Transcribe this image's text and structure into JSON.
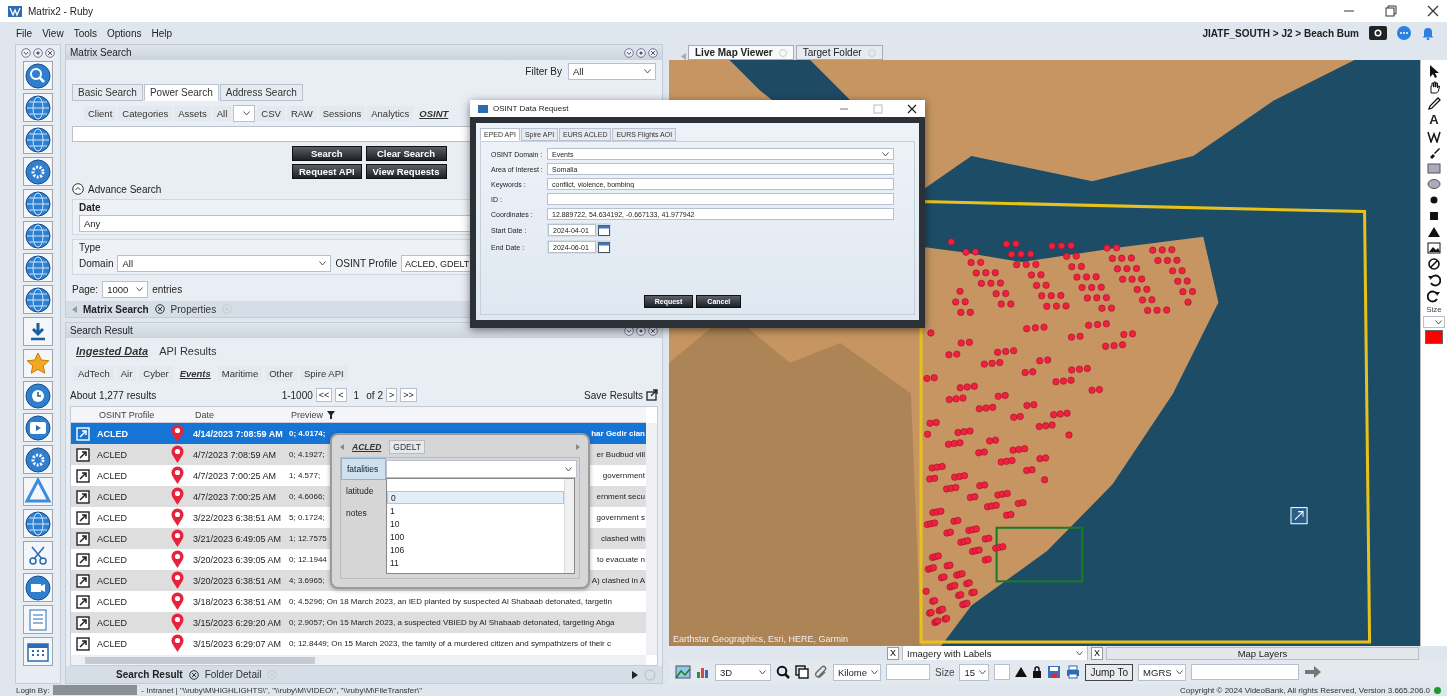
{
  "window": {
    "title": "Matrix2 - Ruby",
    "breadcrumb": "JIATF_SOUTH > J2 > Beach Bum"
  },
  "menu": [
    "File",
    "View",
    "Tools",
    "Options",
    "Help"
  ],
  "matrix_search": {
    "title": "Matrix Search",
    "filter_label": "Filter By",
    "filter_value": "All",
    "tabs": [
      {
        "label": "Basic Search",
        "selected": false
      },
      {
        "label": "Power Search",
        "selected": true
      },
      {
        "label": "Address Search",
        "selected": false
      }
    ],
    "categories": [
      {
        "kind": "tab",
        "label": "Client",
        "selected": false
      },
      {
        "kind": "tab",
        "label": "Categories",
        "selected": false
      },
      {
        "kind": "tab",
        "label": "Assets",
        "selected": false
      },
      {
        "kind": "tab",
        "label": "All",
        "selected": false
      },
      {
        "kind": "dropdown"
      },
      {
        "kind": "tab",
        "label": "CSV",
        "selected": false
      },
      {
        "kind": "tab",
        "label": "RAW",
        "selected": false
      },
      {
        "kind": "tab",
        "label": "Sessions",
        "selected": false
      },
      {
        "kind": "tab",
        "label": "Analytics",
        "selected": false
      },
      {
        "kind": "tab",
        "label": "OSINT",
        "selected": true
      }
    ],
    "buttons": [
      "Search",
      "Clear Search",
      "Request API",
      "View Requests"
    ],
    "advance_search": {
      "label": "Advance Search",
      "expanded": true
    },
    "date": {
      "label": "Date",
      "value": "Any"
    },
    "type": {
      "label": "Type",
      "domain_label": "Domain",
      "domain_value": "All",
      "profile_label": "OSINT Profile",
      "profile_value": "ACLED, GDELT"
    },
    "page": {
      "label": "Page:",
      "value": "1000",
      "suffix": "entries"
    },
    "bottom_tabs": [
      {
        "label": "Matrix Search",
        "selected": true
      },
      {
        "label": "Properties",
        "selected": false
      }
    ]
  },
  "search_result": {
    "title": "Search Result",
    "source_tabs": [
      {
        "label": "Ingested Data",
        "selected": true
      },
      {
        "label": "API Results",
        "selected": false
      }
    ],
    "type_tabs": [
      {
        "label": "AdTech",
        "selected": false
      },
      {
        "label": "Air",
        "selected": false
      },
      {
        "label": "Cyber",
        "selected": false
      },
      {
        "label": "Events",
        "selected": true
      },
      {
        "label": "Maritime",
        "selected": false
      },
      {
        "label": "Other",
        "selected": false
      },
      {
        "label": "Spire API",
        "selected": false
      }
    ],
    "count": "About 1,277 results",
    "range": "1-1000",
    "pager": [
      "<<",
      "<"
    ],
    "page": "1",
    "of": "of",
    "total": "2",
    "pager_next": [
      ">",
      ">>"
    ],
    "save": "Save Results",
    "columns": [
      "OSINT Profile",
      "Date",
      "Preview"
    ],
    "rows": [
      {
        "profile": "ACLED",
        "date": "4/14/2023 7:08:59 AM",
        "preview": "0; 4.0174;",
        "preview_end": "har Gedir clan",
        "selected": true
      },
      {
        "profile": "ACLED",
        "date": "4/7/2023 7:08:59 AM",
        "preview": "0; 4.1927;",
        "preview_end": "er Budbud vill",
        "selected": false
      },
      {
        "profile": "ACLED",
        "date": "4/7/2023 7:00:25 AM",
        "preview": "1; 4.577;",
        "preview_end": "government",
        "selected": false
      },
      {
        "profile": "ACLED",
        "date": "4/7/2023 7:00:25 AM",
        "preview": "0; 4.6066;",
        "preview_end": "ernment secu",
        "selected": false
      },
      {
        "profile": "ACLED",
        "date": "3/22/2023 6:38:51 AM",
        "preview": "5; 0.1724;",
        "preview_end": "government s",
        "selected": false
      },
      {
        "profile": "ACLED",
        "date": "3/21/2023 6:49:05 AM",
        "preview": "1; 12.7575",
        "preview_end": "clashed with",
        "selected": false
      },
      {
        "profile": "ACLED",
        "date": "3/20/2023 6:39:05 AM",
        "preview": "0; 12.1944",
        "preview_end": "to evacuate n",
        "selected": false
      },
      {
        "profile": "ACLED",
        "date": "3/20/2023 6:38:51 AM",
        "preview": "4; 3.6965;",
        "preview_end": "A) clashed in A",
        "selected": false
      },
      {
        "profile": "ACLED",
        "date": "3/18/2023 6:38:51 AM",
        "preview": "0; 4.5296; On 18 March 2023, an IED planted by suspected Al Shabaab detonated, targetin",
        "selected": false
      },
      {
        "profile": "ACLED",
        "date": "3/15/2023 6:29:20 AM",
        "preview": "0; 2.9057; On 15 March 2023, a suspected VBIED by Al Shabaab detonated, targeting Abga",
        "selected": false
      },
      {
        "profile": "ACLED",
        "date": "3/15/2023 6:29:07 AM",
        "preview": "0; 12.8449; On 15 March 2023, the family of a murdered citizen and sympathizers of their c",
        "selected": false
      }
    ],
    "bottom_tabs": [
      {
        "label": "Search Result",
        "selected": true
      },
      {
        "label": "Folder Detail",
        "selected": false
      }
    ]
  },
  "map_viewer": {
    "tabs": [
      {
        "label": "Live Map Viewer",
        "selected": true
      },
      {
        "label": "Target Folder",
        "selected": false
      }
    ],
    "attribution": "Earthstar Geographics, Esri, HERE, Garmin",
    "text_tool": "A",
    "size_label": "Size",
    "basemap": {
      "close": "X",
      "value": "Imagery with Labels"
    },
    "layers": {
      "close": "X",
      "label": "Map Layers"
    },
    "toolbar": {
      "view_mode": "3D",
      "unit": "Kilome",
      "size_label": "Size",
      "size_value": "15",
      "jump_button": "Jump To",
      "grid": "MGRS"
    }
  },
  "osint_dialog": {
    "title": "OSINT Data Request",
    "tabs": [
      {
        "label": "EPED API",
        "selected": true
      },
      {
        "label": "Spire API",
        "selected": false
      },
      {
        "label": "EURS ACLED",
        "selected": false
      },
      {
        "label": "EURS Flights AOI",
        "selected": false
      }
    ],
    "fields": [
      {
        "kind": "dropdown",
        "label": "OSINT Domain :",
        "value": "Events"
      },
      {
        "kind": "text",
        "label": "Area of Interest :",
        "value": "Somalia"
      },
      {
        "kind": "text",
        "label": "Keywords :",
        "value": "conflict, violence, bombing"
      },
      {
        "kind": "text",
        "label": "ID :"
      },
      {
        "kind": "text",
        "label": "Coordinates :",
        "value": "12.889722, 54.634192, -0.667133, 41.977942"
      },
      {
        "kind": "date",
        "label": "Start Date :",
        "value": "2024-04-01"
      },
      {
        "kind": "date",
        "label": "End Date :",
        "value": "2024-06-01"
      }
    ],
    "buttons": [
      "Request",
      "Cancel"
    ]
  },
  "profile_popup": {
    "tabs": [
      {
        "label": "ACLED",
        "selected": true
      },
      {
        "label": "GDELT",
        "selected": false
      }
    ],
    "fields": [
      "fatalities",
      "latitude",
      "notes"
    ],
    "options": [
      {
        "label": "0",
        "selected": true
      },
      {
        "label": "1",
        "selected": false
      },
      {
        "label": "10",
        "selected": false
      },
      {
        "label": "100",
        "selected": false
      },
      {
        "label": "106",
        "selected": false
      },
      {
        "label": "11",
        "selected": false
      }
    ]
  },
  "status_bar": {
    "login_label": "Login By:",
    "paths": "- Intranet | \"\\\\ruby\\M\\HIGHLIGHTS\\\", \"\\\\ruby\\M\\VIDEO\\\", \"\\\\ruby\\M\\FileTransfer\\\"",
    "copyright": "Copyright © 2024 VideoBank, All rights Reserved, Version 3.665.206.0"
  }
}
